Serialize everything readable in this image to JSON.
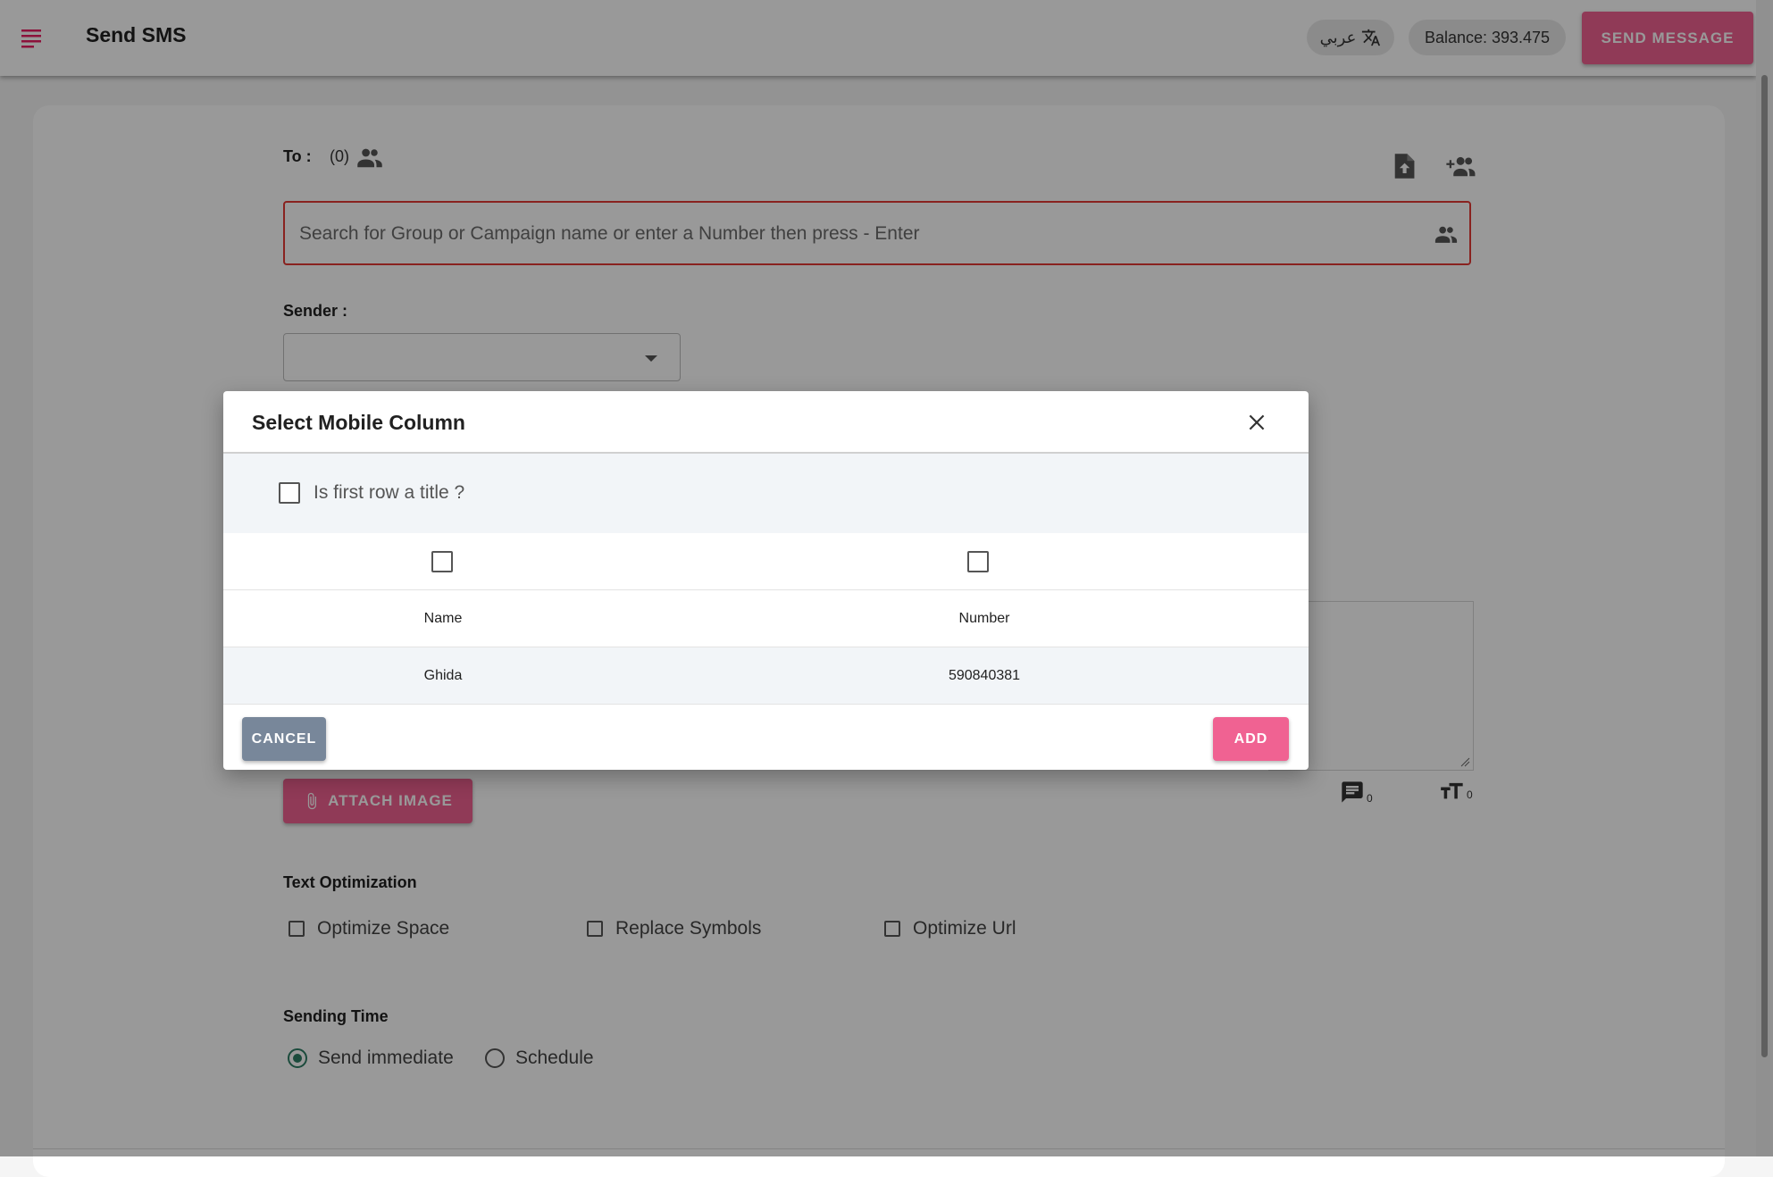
{
  "header": {
    "title": "Send SMS",
    "language_label": "عربي",
    "balance": "Balance: 393.475",
    "send_button": "SEND MESSAGE"
  },
  "form": {
    "to_label": "To :",
    "to_count": "(0)",
    "search_placeholder": "Search for Group or Campaign name or enter a Number then press - Enter",
    "sender_label": "Sender :",
    "sender_value": "",
    "attach_label": "ATTACH IMAGE",
    "message_count": "0",
    "char_count": "0",
    "text_optimization": {
      "title": "Text Optimization",
      "options": [
        {
          "label": "Optimize Space",
          "checked": false
        },
        {
          "label": "Replace Symbols",
          "checked": false
        },
        {
          "label": "Optimize Url",
          "checked": false
        }
      ]
    },
    "sending_time": {
      "title": "Sending Time",
      "options": [
        {
          "label": "Send immediate",
          "checked": true
        },
        {
          "label": "Schedule",
          "checked": false
        }
      ]
    }
  },
  "dialog": {
    "title": "Select Mobile Column",
    "first_row_label": "Is first row a title ?",
    "columns": [
      {
        "header": "Name",
        "value": "Ghida"
      },
      {
        "header": "Number",
        "value": "590840381"
      }
    ],
    "cancel_label": "CANCEL",
    "add_label": "ADD"
  },
  "icons": {
    "menu": "menu-icon",
    "translate": "translate-icon",
    "people": "people-icon",
    "upload": "file-upload-icon",
    "add_person": "add-person-icon",
    "close": "close-icon",
    "attach": "paperclip-icon",
    "message": "message-icon",
    "text_size": "text-size-icon"
  },
  "colors": {
    "accent": "#f06292",
    "error": "#e53935",
    "radio_checked": "#2e7d64",
    "cancel": "#78879a"
  }
}
